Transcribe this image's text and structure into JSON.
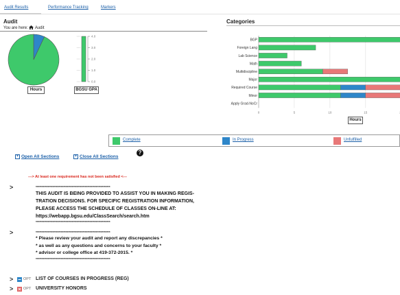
{
  "tabs": [
    {
      "label": "Audit Results"
    },
    {
      "label": "Performance Tracking"
    },
    {
      "label": "Markers"
    }
  ],
  "audit": {
    "title": "Audit",
    "breadcrumb_prefix": "You are here:",
    "breadcrumb_page": "Audit"
  },
  "charts_small": {
    "hours_label": "Hours",
    "gpa_label": "BGSU GPA"
  },
  "categories_title": "Categories",
  "colors": {
    "complete": "#3ec96b",
    "in_progress": "#2e86c9",
    "unfulfilled": "#e87878"
  },
  "chart_data": [
    {
      "type": "pie",
      "xlabel": "Hours",
      "slices": [
        {
          "label": "Complete",
          "value": 93
        },
        {
          "label": "In Progress",
          "value": 7
        }
      ]
    },
    {
      "type": "bar",
      "xlabel": "BGSU GPA",
      "categories": [
        ""
      ],
      "values": [
        4.0
      ],
      "yticks": [
        "4.0",
        "3.0",
        "2.0",
        "1.0",
        "0.0"
      ],
      "ylim": [
        0,
        4
      ]
    },
    {
      "type": "bar",
      "orientation": "horizontal",
      "stacked": true,
      "xlabel": "Hours",
      "categories": [
        "BGP",
        "Foreign Lang",
        "Lab Science",
        "Math",
        "Multidiscipline",
        "Major",
        "Required Course",
        "Minor",
        "Apply Grad-NoCr"
      ],
      "xticks": [
        "0",
        "5",
        "10",
        "15",
        "20"
      ],
      "xlim": [
        0,
        21
      ],
      "series": [
        {
          "name": "Complete",
          "values": [
            21,
            8,
            4,
            6,
            9,
            21,
            11.5,
            11.5,
            0
          ]
        },
        {
          "name": "In Progress",
          "values": [
            0,
            0,
            0,
            0,
            0,
            0,
            3.5,
            3.5,
            0
          ]
        },
        {
          "name": "Unfulfilled",
          "values": [
            0,
            0,
            0,
            0,
            3.5,
            0,
            6,
            6,
            0
          ]
        }
      ]
    }
  ],
  "legend": [
    {
      "label": "Complete"
    },
    {
      "label": "In Progress"
    },
    {
      "label": "Unfulfilled"
    }
  ],
  "sections": {
    "open_all": "Open All Sections",
    "close_all": "Close All Sections"
  },
  "requirement_note": "---> At least one requirement has not been satisfied <---",
  "notice1": {
    "stars": "**************************************************************",
    "lines": [
      "THIS AUDIT IS BEING PROVIDED TO ASSIST YOU IN MAKING REGIS-",
      "TRATION DECISIONS. FOR SPECIFIC REGISTRATION INFORMATION,",
      "PLEASE ACCESS THE SCHEDULE OF CLASSES ON-LINE AT:",
      "https://webapp.bgsu.edu/ClassSearch/search.htm"
    ]
  },
  "notice2": {
    "stars": "**************************************************************",
    "lines": [
      "* Please review your audit and report any discrepancies *",
      "* as well as any questions and concerns to your faculty *",
      "* advisor or college office at 419-372-2015. *"
    ]
  },
  "opt_rows": [
    {
      "tag": "OPT",
      "label": "LIST OF COURSES IN PROGRESS (REG)",
      "status": "in-progress"
    },
    {
      "tag": "OPT",
      "label": "UNIVERSITY HONORS",
      "status": "unfulfilled"
    }
  ]
}
